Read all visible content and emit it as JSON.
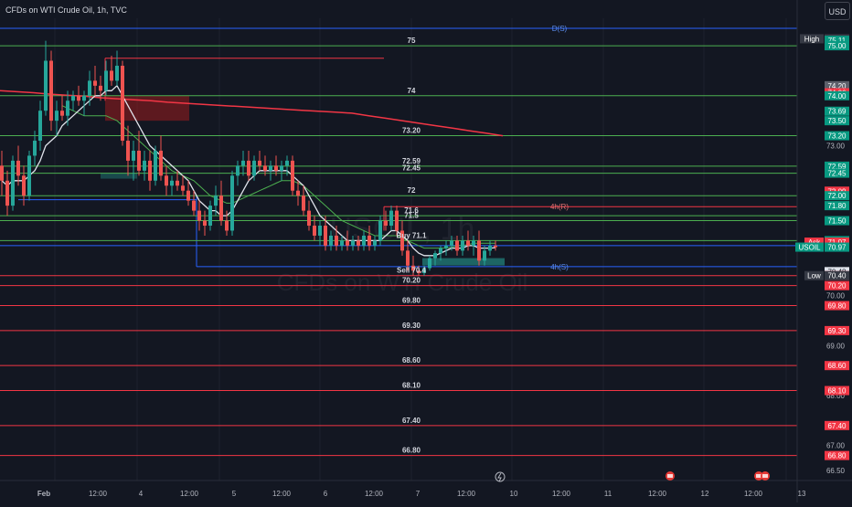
{
  "header": {
    "title": "CFDs on WTI Crude Oil, 1h, TVC",
    "currency": "USD"
  },
  "watermark": {
    "line1": "USOIL, 1h",
    "line2": "CFDs on WTI Crude Oil"
  },
  "colors": {
    "background": "#131722",
    "grid": "#1e222d",
    "bull": "#26a69a",
    "bear": "#ef5350",
    "support_line": "#4caf50",
    "resistance_line": "#f23645",
    "ma_white": "#e0e3eb",
    "ma_green": "#4caf50",
    "ma_red": "#f23645",
    "blue_level": "#2962ff"
  },
  "chart_data": {
    "type": "candlestick",
    "title": "CFDs on WTI Crude Oil, 1h, TVC",
    "symbol": "USOIL",
    "ylim": [
      66.3,
      75.55
    ],
    "y_ticks": [
      "66.50",
      "67.00",
      "67.40",
      "68.00",
      "68.60",
      "69.00",
      "69.30",
      "70.00",
      "70.20",
      "70.40",
      "71.00",
      "71.50",
      "72.00",
      "72.45",
      "73.00",
      "73.50",
      "74.00",
      "74.20"
    ],
    "x_tick_labels": [
      "Feb",
      "12:00",
      "4",
      "12:00",
      "5",
      "12:00",
      "6",
      "12:00",
      "7",
      "12:00",
      "10",
      "12:00",
      "11",
      "12:00",
      "12",
      "12:00",
      "13"
    ],
    "horizontal_levels": [
      {
        "price": 75.0,
        "label": "75",
        "color": "green"
      },
      {
        "price": 74.0,
        "label": "74",
        "color": "green"
      },
      {
        "price": 73.2,
        "label": "73.20",
        "color": "green"
      },
      {
        "price": 72.59,
        "label": "72.59",
        "color": "green"
      },
      {
        "price": 72.45,
        "label": "72.45",
        "color": "green"
      },
      {
        "price": 72.0,
        "label": "72",
        "color": "green"
      },
      {
        "price": 71.6,
        "label": "71.6",
        "color": "green"
      },
      {
        "price": 71.5,
        "label": "71.5",
        "color": "green"
      },
      {
        "price": 71.1,
        "label": "Buy 71.1",
        "color": "green"
      },
      {
        "price": 70.4,
        "label": "Sell 70.4",
        "color": "red"
      },
      {
        "price": 70.2,
        "label": "70.20",
        "color": "red"
      },
      {
        "price": 69.8,
        "label": "69.80",
        "color": "red"
      },
      {
        "price": 69.3,
        "label": "69.30",
        "color": "red"
      },
      {
        "price": 68.6,
        "label": "68.60",
        "color": "red"
      },
      {
        "price": 68.1,
        "label": "68.10",
        "color": "red"
      },
      {
        "price": 67.4,
        "label": "67.40",
        "color": "red"
      },
      {
        "price": 66.8,
        "label": "66.80",
        "color": "red"
      }
    ],
    "zone_labels": [
      {
        "label": "D(S)",
        "price": 75.35
      },
      {
        "label": "4h(R)",
        "price": 71.78
      },
      {
        "label": "4h(S)",
        "price": 70.58
      }
    ],
    "price_tags": [
      {
        "label": "High",
        "value": "75.14",
        "kind": "high"
      },
      {
        "label": "",
        "value": "75.11",
        "kind": "green"
      },
      {
        "label": "",
        "value": "75.00",
        "kind": "green"
      },
      {
        "label": "",
        "value": "74.20",
        "kind": "gray"
      },
      {
        "label": "",
        "value": "74.06",
        "kind": "red"
      },
      {
        "label": "",
        "value": "74.00",
        "kind": "green"
      },
      {
        "label": "",
        "value": "73.69",
        "kind": "green"
      },
      {
        "label": "",
        "value": "73.50",
        "kind": "green"
      },
      {
        "label": "",
        "value": "73.20",
        "kind": "green"
      },
      {
        "label": "",
        "value": "72.59",
        "kind": "gray"
      },
      {
        "label": "",
        "value": "72.59",
        "kind": "green"
      },
      {
        "label": "",
        "value": "72.45",
        "kind": "green"
      },
      {
        "label": "",
        "value": "72.09",
        "kind": "red"
      },
      {
        "label": "",
        "value": "72.00",
        "kind": "green"
      },
      {
        "label": "",
        "value": "71.80",
        "kind": "green"
      },
      {
        "label": "",
        "value": "71.50",
        "kind": "green"
      },
      {
        "label": "",
        "value": "71.10",
        "kind": "green"
      },
      {
        "label": "Ask",
        "value": "71.07",
        "kind": "red"
      },
      {
        "label": "Bid",
        "value": "70.97",
        "kind": "blue"
      },
      {
        "label": "USOIL",
        "value": "70.97",
        "kind": "green"
      },
      {
        "label": "",
        "value": "70.48",
        "kind": "white"
      },
      {
        "label": "",
        "value": "70.40",
        "kind": "red"
      },
      {
        "label": "Low",
        "value": "70.40",
        "kind": "low"
      },
      {
        "label": "",
        "value": "70.20",
        "kind": "red"
      },
      {
        "label": "",
        "value": "69.80",
        "kind": "red"
      },
      {
        "label": "",
        "value": "69.30",
        "kind": "red"
      },
      {
        "label": "",
        "value": "68.60",
        "kind": "red"
      },
      {
        "label": "",
        "value": "68.10",
        "kind": "red"
      },
      {
        "label": "",
        "value": "67.40",
        "kind": "red"
      },
      {
        "label": "",
        "value": "66.80",
        "kind": "red"
      }
    ],
    "right_note": "73.50",
    "candles": [
      [
        72.6,
        72.9,
        72.0,
        72.3
      ],
      [
        72.3,
        72.5,
        71.6,
        71.8
      ],
      [
        71.8,
        72.8,
        71.7,
        72.7
      ],
      [
        72.7,
        73.0,
        72.2,
        72.4
      ],
      [
        72.4,
        72.6,
        71.8,
        72.0
      ],
      [
        72.0,
        72.9,
        71.9,
        72.8
      ],
      [
        72.8,
        73.3,
        72.6,
        73.1
      ],
      [
        73.1,
        73.9,
        72.9,
        73.7
      ],
      [
        73.7,
        75.1,
        73.6,
        74.7
      ],
      [
        74.7,
        74.9,
        73.3,
        73.5
      ],
      [
        73.5,
        73.9,
        73.2,
        73.7
      ],
      [
        73.7,
        74.0,
        73.5,
        73.6
      ],
      [
        73.6,
        74.1,
        73.4,
        73.9
      ],
      [
        73.9,
        74.1,
        73.7,
        74.0
      ],
      [
        74.0,
        74.2,
        73.8,
        73.9
      ],
      [
        73.9,
        74.1,
        73.6,
        74.0
      ],
      [
        74.0,
        74.5,
        73.8,
        74.3
      ],
      [
        74.3,
        74.6,
        74.0,
        74.2
      ],
      [
        74.2,
        74.4,
        73.9,
        74.1
      ],
      [
        74.1,
        74.7,
        74.0,
        74.5
      ],
      [
        74.5,
        74.8,
        74.2,
        74.3
      ],
      [
        74.3,
        74.9,
        74.2,
        74.6
      ],
      [
        74.6,
        74.7,
        73.0,
        73.1
      ],
      [
        73.1,
        73.4,
        72.4,
        72.7
      ],
      [
        72.7,
        73.1,
        72.3,
        72.9
      ],
      [
        72.9,
        73.3,
        72.4,
        72.5
      ],
      [
        72.5,
        72.9,
        72.3,
        72.7
      ],
      [
        72.7,
        72.9,
        72.1,
        72.3
      ],
      [
        72.3,
        73.0,
        72.2,
        72.9
      ],
      [
        72.9,
        73.2,
        72.3,
        72.4
      ],
      [
        72.4,
        72.6,
        72.0,
        72.2
      ],
      [
        72.2,
        72.4,
        72.0,
        72.3
      ],
      [
        72.3,
        72.5,
        72.1,
        72.2
      ],
      [
        72.2,
        72.4,
        72.0,
        72.1
      ],
      [
        72.1,
        72.3,
        71.8,
        71.9
      ],
      [
        71.9,
        72.1,
        71.6,
        71.7
      ],
      [
        71.7,
        71.9,
        71.3,
        71.5
      ],
      [
        71.5,
        71.7,
        71.2,
        71.4
      ],
      [
        71.4,
        71.9,
        71.3,
        71.8
      ],
      [
        71.8,
        72.2,
        71.6,
        72.0
      ],
      [
        72.0,
        72.3,
        71.4,
        71.5
      ],
      [
        71.5,
        71.7,
        71.2,
        71.3
      ],
      [
        71.3,
        72.5,
        71.2,
        72.4
      ],
      [
        72.4,
        72.7,
        72.2,
        72.6
      ],
      [
        72.6,
        72.9,
        72.4,
        72.7
      ],
      [
        72.7,
        72.9,
        72.3,
        72.4
      ],
      [
        72.4,
        72.8,
        72.3,
        72.7
      ],
      [
        72.7,
        72.9,
        72.5,
        72.6
      ],
      [
        72.6,
        72.8,
        72.4,
        72.5
      ],
      [
        72.5,
        72.7,
        72.3,
        72.6
      ],
      [
        72.6,
        72.8,
        72.4,
        72.5
      ],
      [
        72.5,
        72.7,
        72.3,
        72.6
      ],
      [
        72.6,
        72.8,
        72.4,
        72.7
      ],
      [
        72.7,
        72.8,
        72.0,
        72.1
      ],
      [
        72.1,
        72.3,
        71.8,
        72.0
      ],
      [
        72.0,
        72.2,
        71.6,
        71.7
      ],
      [
        71.7,
        71.9,
        71.3,
        71.4
      ],
      [
        71.4,
        71.6,
        71.1,
        71.2
      ],
      [
        71.2,
        71.5,
        71.0,
        71.4
      ],
      [
        71.4,
        71.6,
        70.9,
        71.0
      ],
      [
        71.0,
        71.3,
        70.9,
        71.2
      ],
      [
        71.2,
        71.4,
        70.9,
        71.0
      ],
      [
        71.0,
        71.2,
        70.9,
        71.1
      ],
      [
        71.1,
        71.3,
        70.9,
        71.0
      ],
      [
        71.0,
        71.2,
        70.9,
        71.1
      ],
      [
        71.1,
        71.2,
        70.9,
        71.0
      ],
      [
        71.0,
        71.3,
        70.9,
        71.2
      ],
      [
        71.2,
        71.4,
        70.9,
        71.0
      ],
      [
        71.0,
        71.2,
        70.9,
        71.1
      ],
      [
        71.1,
        71.6,
        71.0,
        71.5
      ],
      [
        71.5,
        71.7,
        71.3,
        71.4
      ],
      [
        71.4,
        71.8,
        71.3,
        71.7
      ],
      [
        71.7,
        71.8,
        71.2,
        71.3
      ],
      [
        71.3,
        71.5,
        70.8,
        70.9
      ],
      [
        70.9,
        71.1,
        70.5,
        70.6
      ],
      [
        70.6,
        70.8,
        70.4,
        70.5
      ],
      [
        70.5,
        70.6,
        70.4,
        70.45
      ],
      [
        70.45,
        70.6,
        70.4,
        70.55
      ],
      [
        70.55,
        70.8,
        70.5,
        70.75
      ],
      [
        70.75,
        70.9,
        70.6,
        70.85
      ],
      [
        70.85,
        71.0,
        70.7,
        70.95
      ],
      [
        70.95,
        71.1,
        70.8,
        71.0
      ],
      [
        71.0,
        71.2,
        70.9,
        71.1
      ],
      [
        71.1,
        71.2,
        70.8,
        70.9
      ],
      [
        70.9,
        71.2,
        70.8,
        71.1
      ],
      [
        71.1,
        71.3,
        70.9,
        71.0
      ],
      [
        71.0,
        71.2,
        70.8,
        71.1
      ],
      [
        71.1,
        71.3,
        70.6,
        70.7
      ],
      [
        70.7,
        71.0,
        70.6,
        70.9
      ],
      [
        70.9,
        71.1,
        70.8,
        71.0
      ],
      [
        71.0,
        71.1,
        70.9,
        70.97
      ]
    ],
    "ma_white": [
      72.3,
      72.2,
      72.3,
      72.3,
      72.3,
      72.4,
      72.5,
      72.7,
      73.0,
      73.1,
      73.2,
      73.4,
      73.5,
      73.6,
      73.7,
      73.8,
      73.9,
      74.0,
      74.0,
      74.1,
      74.1,
      74.2,
      74.0,
      73.8,
      73.6,
      73.4,
      73.2,
      73.0,
      72.9,
      72.8,
      72.7,
      72.6,
      72.5,
      72.4,
      72.3,
      72.1,
      71.9,
      71.8,
      71.7,
      71.7,
      71.6,
      71.6,
      71.7,
      71.9,
      72.1,
      72.3,
      72.4,
      72.5,
      72.5,
      72.5,
      72.5,
      72.5,
      72.5,
      72.4,
      72.3,
      72.2,
      72.0,
      71.8,
      71.6,
      71.5,
      71.4,
      71.3,
      71.2,
      71.1,
      71.1,
      71.1,
      71.1,
      71.1,
      71.1,
      71.1,
      71.2,
      71.3,
      71.3,
      71.2,
      71.1,
      70.95,
      70.85,
      70.8,
      70.8,
      70.8,
      70.85,
      70.9,
      70.95,
      70.95,
      70.95,
      71.0,
      71.0,
      70.95,
      70.95,
      70.95,
      70.96
    ],
    "ma_green": [
      null,
      null,
      null,
      null,
      null,
      null,
      null,
      null,
      null,
      null,
      null,
      73.8,
      73.75,
      73.7,
      73.65,
      73.6,
      73.6,
      73.6,
      73.6,
      73.6,
      73.55,
      73.5,
      73.4,
      73.3,
      73.2,
      73.1,
      73.0,
      72.9,
      72.8,
      72.7,
      72.6,
      72.5,
      72.45,
      72.4,
      72.35,
      72.3,
      72.2,
      72.1,
      72.0,
      71.95,
      71.9,
      71.85,
      71.85,
      71.9,
      71.95,
      72.0,
      72.05,
      72.1,
      72.15,
      72.2,
      72.25,
      72.3,
      72.3,
      72.3,
      72.25,
      72.2,
      72.1,
      72.0,
      71.9,
      71.8,
      71.7,
      71.6,
      71.5,
      71.45,
      71.4,
      71.35,
      71.3,
      71.25,
      71.2,
      71.2,
      71.2,
      71.2,
      71.2,
      71.15,
      71.1,
      71.05,
      71.0,
      70.95,
      70.95,
      70.95,
      70.95,
      70.95,
      70.97,
      71.0,
      71.0,
      71.02,
      71.05,
      71.05,
      71.05,
      71.05,
      71.05
    ],
    "ma_red": [
      74.1,
      74.08,
      74.06,
      74.03,
      74.01,
      73.99,
      73.96,
      73.94,
      73.92,
      73.9,
      73.87,
      73.85,
      73.83,
      73.81,
      73.79,
      73.77,
      73.75,
      73.73,
      73.71,
      73.69,
      73.67,
      73.65,
      73.6,
      73.55,
      73.5,
      73.45,
      73.4,
      73.35,
      73.3,
      73.25,
      73.2
    ]
  }
}
